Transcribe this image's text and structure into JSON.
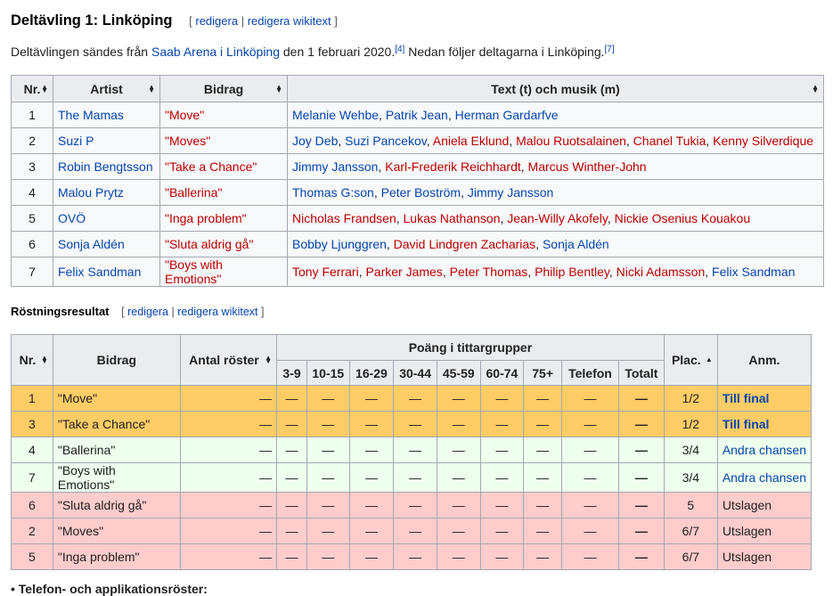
{
  "section": {
    "title": "Deltävling 1: Linköping",
    "edit": {
      "open": "[",
      "edit_label": "redigera",
      "sep": "|",
      "wikitext_label": "redigera wikitext",
      "close": "]"
    }
  },
  "intro": {
    "pre": "Deltävlingen sändes från",
    "venue": "Saab Arena i Linköping",
    "mid": "den 1 februari 2020.",
    "ref1": "[4]",
    "post": "Nedan följer deltagarna i Linköping.",
    "ref2": "[7]"
  },
  "entries_table": {
    "headers": [
      "Nr.",
      "Artist",
      "Bidrag",
      "Text (t) och musik (m)"
    ],
    "rows": [
      {
        "nr": "1",
        "artist": "The Mamas",
        "song": "\"Move\"",
        "writers": [
          {
            "name": "Melanie Wehbe",
            "link": "blue"
          },
          {
            "name": "Patrik Jean",
            "link": "blue"
          },
          {
            "name": "Herman Gardarfve",
            "link": "blue"
          }
        ]
      },
      {
        "nr": "2",
        "artist": "Suzi P",
        "song": "\"Moves\"",
        "writers": [
          {
            "name": "Joy Deb",
            "link": "blue"
          },
          {
            "name": "Suzi Pancekov",
            "link": "blue"
          },
          {
            "name": "Aniela Eklund",
            "link": "red"
          },
          {
            "name": "Malou Ruotsalainen",
            "link": "red"
          },
          {
            "name": "Chanel Tukia",
            "link": "red"
          },
          {
            "name": "Kenny Silverdique",
            "link": "red"
          }
        ]
      },
      {
        "nr": "3",
        "artist": "Robin Bengtsson",
        "song": "\"Take a Chance\"",
        "writers": [
          {
            "name": "Jimmy Jansson",
            "link": "blue"
          },
          {
            "name": "Karl-Frederik Reichhardt",
            "link": "red"
          },
          {
            "name": "Marcus Winther-John",
            "link": "red"
          }
        ]
      },
      {
        "nr": "4",
        "artist": "Malou Prytz",
        "song": "\"Ballerina\"",
        "writers": [
          {
            "name": "Thomas G:son",
            "link": "blue"
          },
          {
            "name": "Peter Boström",
            "link": "blue"
          },
          {
            "name": "Jimmy Jansson",
            "link": "blue"
          }
        ]
      },
      {
        "nr": "5",
        "artist": "OVÖ",
        "song": "\"Inga problem\"",
        "writers": [
          {
            "name": "Nicholas Frandsen",
            "link": "red"
          },
          {
            "name": "Lukas Nathanson",
            "link": "red"
          },
          {
            "name": "Jean-Willy Akofely",
            "link": "red"
          },
          {
            "name": "Nickie Osenius Kouakou",
            "link": "red"
          }
        ]
      },
      {
        "nr": "6",
        "artist": "Sonja Aldén",
        "song": "\"Sluta aldrig gå\"",
        "writers": [
          {
            "name": "Bobby Ljunggren",
            "link": "blue"
          },
          {
            "name": "David Lindgren Zacharias",
            "link": "red"
          },
          {
            "name": "Sonja Aldén",
            "link": "blue"
          }
        ]
      },
      {
        "nr": "7",
        "artist": "Felix Sandman",
        "song": "\"Boys with Emotions\"",
        "writers": [
          {
            "name": "Tony Ferrari",
            "link": "red"
          },
          {
            "name": "Parker James",
            "link": "red"
          },
          {
            "name": "Peter Thomas",
            "link": "red"
          },
          {
            "name": "Philip Bentley",
            "link": "red"
          },
          {
            "name": "Nicki Adamsson",
            "link": "red"
          },
          {
            "name": "Felix Sandman",
            "link": "blue"
          }
        ]
      }
    ]
  },
  "results": {
    "title": "Röstningsresultat",
    "edit": {
      "open": "[",
      "edit_label": "redigera",
      "sep": "|",
      "wikitext_label": "redigera wikitext",
      "close": "]"
    },
    "headers": {
      "nr": "Nr.",
      "song": "Bidrag",
      "votes": "Antal röster",
      "group": "Poäng i tittargrupper",
      "place": "Plac.",
      "note": "Anm.",
      "sub": [
        "3-9",
        "10-15",
        "16-29",
        "30-44",
        "45-59",
        "60-74",
        "75+",
        "Telefon",
        "Totalt"
      ]
    },
    "rows": [
      {
        "nr": "1",
        "song": "\"Move\"",
        "votes": "—",
        "points": [
          "—",
          "—",
          "—",
          "—",
          "—",
          "—",
          "—",
          "—"
        ],
        "total": "—",
        "place": "1/2",
        "note": "Till final",
        "status": "final"
      },
      {
        "nr": "3",
        "song": "\"Take a Chance\"",
        "votes": "—",
        "points": [
          "—",
          "—",
          "—",
          "—",
          "—",
          "—",
          "—",
          "—"
        ],
        "total": "—",
        "place": "1/2",
        "note": "Till final",
        "status": "final"
      },
      {
        "nr": "4",
        "song": "\"Ballerina\"",
        "votes": "—",
        "points": [
          "—",
          "—",
          "—",
          "—",
          "—",
          "—",
          "—",
          "—"
        ],
        "total": "—",
        "place": "3/4",
        "note": "Andra chansen",
        "status": "second"
      },
      {
        "nr": "7",
        "song": "\"Boys with Emotions\"",
        "votes": "—",
        "points": [
          "—",
          "—",
          "—",
          "—",
          "—",
          "—",
          "—",
          "—"
        ],
        "total": "—",
        "place": "3/4",
        "note": "Andra chansen",
        "status": "second"
      },
      {
        "nr": "6",
        "song": "\"Sluta aldrig gå\"",
        "votes": "—",
        "points": [
          "—",
          "—",
          "—",
          "—",
          "—",
          "—",
          "—",
          "—"
        ],
        "total": "—",
        "place": "5",
        "note": "Utslagen",
        "status": "out"
      },
      {
        "nr": "2",
        "song": "\"Moves\"",
        "votes": "—",
        "points": [
          "—",
          "—",
          "—",
          "—",
          "—",
          "—",
          "—",
          "—"
        ],
        "total": "—",
        "place": "6/7",
        "note": "Utslagen",
        "status": "out"
      },
      {
        "nr": "5",
        "song": "\"Inga problem\"",
        "votes": "—",
        "points": [
          "—",
          "—",
          "—",
          "—",
          "—",
          "—",
          "—",
          "—"
        ],
        "total": "—",
        "place": "6/7",
        "note": "Utslagen",
        "status": "out"
      }
    ]
  },
  "footer_text": "Telefon- och applikationsröster:",
  "colors": {
    "final": "#ffcc66",
    "second": "#eeffee",
    "out": "#ffcccc",
    "link": "#0645ad",
    "redlink": "#ba0000"
  }
}
